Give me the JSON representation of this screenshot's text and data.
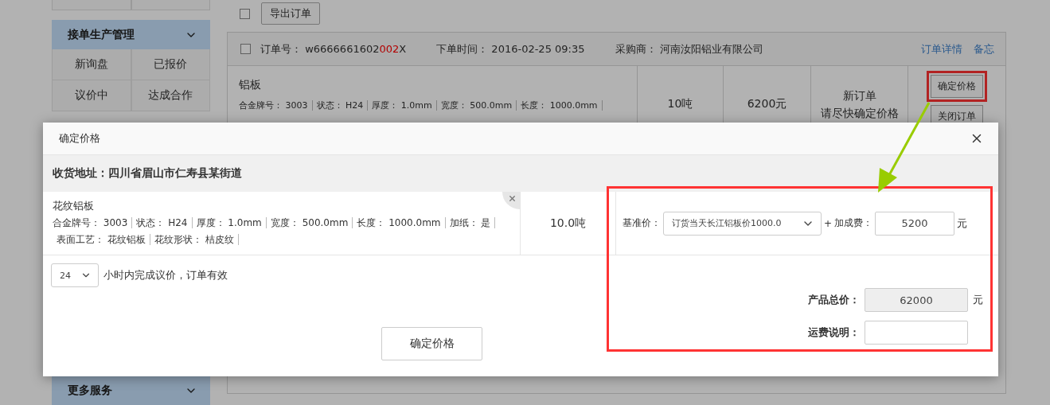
{
  "sidebar": {
    "sections": [
      {
        "title": "接单生产管理",
        "items": [
          "新询盘",
          "已报价",
          "议价中",
          "达成合作"
        ]
      },
      {
        "title": "更多服务"
      }
    ]
  },
  "toolbar": {
    "checked": false,
    "export_button": "导出订单"
  },
  "order": {
    "checked": false,
    "number_label": "订单号：",
    "number_parts": [
      {
        "text": "w6666661602",
        "highlight": false
      },
      {
        "text": "002",
        "highlight": true
      },
      {
        "text": "X",
        "highlight": false
      }
    ],
    "time_label": "下单时间：",
    "time": "2016-02-25 09:35",
    "buyer_label": "采购商：",
    "buyer": "河南汝阳铝业有限公司",
    "links": [
      "订单详情",
      "备忘"
    ],
    "product": {
      "name": "铝板",
      "specs": [
        {
          "label": "合金牌号：",
          "value": "3003"
        },
        {
          "label": "状态：",
          "value": "H24"
        },
        {
          "label": "厚度：",
          "value": "1.0mm"
        },
        {
          "label": "宽度：",
          "value": "500.0mm"
        },
        {
          "label": "长度：",
          "value": "1000.0mm"
        }
      ]
    },
    "quantity": "10吨",
    "price": "6200元",
    "status": [
      "新订单",
      "请尽快确定价格"
    ],
    "actions": [
      {
        "label": "确定价格",
        "highlighted": true
      },
      {
        "label": "关闭订单",
        "highlighted": false
      }
    ]
  },
  "dialog": {
    "title": "确定价格",
    "address_label": "收货地址：",
    "address": "四川省眉山市仁寿县某街道",
    "item": {
      "name": "花纹铝板",
      "specs": [
        {
          "label": "合金牌号：",
          "value": "3003"
        },
        {
          "label": "状态：",
          "value": "H24"
        },
        {
          "label": "厚度：",
          "value": "1.0mm"
        },
        {
          "label": "宽度：",
          "value": "500.0mm"
        },
        {
          "label": "长度：",
          "value": "1000.0mm"
        },
        {
          "label": "加纸：",
          "value": "是"
        },
        {
          "label": "表面工艺：",
          "value": "花纹铝板"
        },
        {
          "label": "花纹形状：",
          "value": "桔皮纹"
        }
      ],
      "quantity": "10.0吨"
    },
    "pricing": {
      "base_label": "基准价：",
      "base_value": "订货当天长江铝板价1000.0",
      "plus": "+",
      "markup_label": "加成费：",
      "markup_value": "5200",
      "unit": "元"
    },
    "validity": {
      "hours": "24",
      "text": "小时内完成议价，订单有效"
    },
    "total": {
      "label": "产品总价：",
      "value": "62000",
      "unit": "元"
    },
    "shipping": {
      "label": "运费说明："
    },
    "confirm_button": "确定价格"
  }
}
